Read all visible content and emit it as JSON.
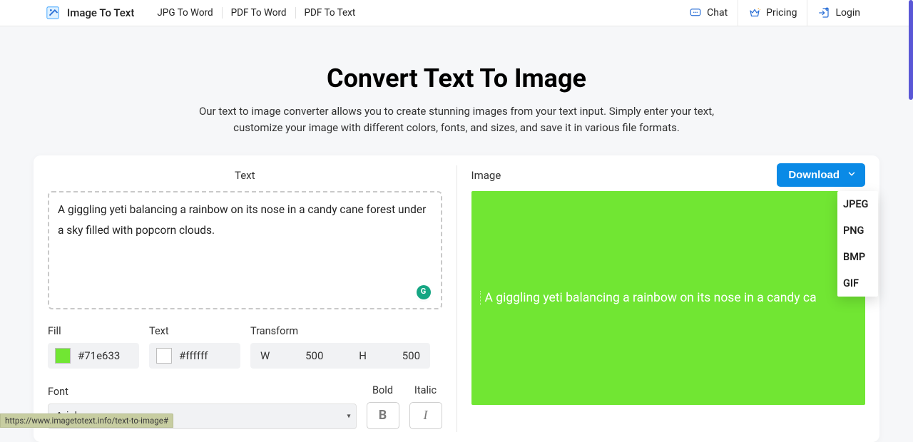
{
  "header": {
    "logo_text": "Image To Text",
    "nav": [
      "JPG To Word",
      "PDF To Word",
      "PDF To Text"
    ],
    "right": {
      "chat": "Chat",
      "pricing": "Pricing",
      "login": "Login"
    }
  },
  "page": {
    "title": "Convert Text To Image",
    "subtitle": "Our text to image converter allows you to create stunning images from your text input. Simply enter your text, customize your image with different colors, fonts, and sizes, and save it in various file formats."
  },
  "left_pane": {
    "title": "Text",
    "text_value": "A giggling yeti balancing a rainbow on its nose in a candy cane forest under a sky filled with popcorn clouds.",
    "fill_label": "Fill",
    "fill_value": "#71e633",
    "text_label": "Text",
    "text_color_value": "#ffffff",
    "transform_label": "Transform",
    "w_label": "W",
    "w_value": "500",
    "h_label": "H",
    "h_value": "500",
    "font_label": "Font",
    "font_value": "Arial",
    "bold_label": "Bold",
    "bold_btn": "B",
    "italic_label": "Italic",
    "italic_btn": "I",
    "grammarly_badge": "G"
  },
  "right_pane": {
    "title": "Image",
    "download_label": "Download",
    "preview_text": "A giggling yeti balancing a rainbow on its nose in a candy ca",
    "menu": [
      "JPEG",
      "PNG",
      "BMP",
      "GIF"
    ]
  },
  "status_url": "https://www.imagetotext.info/text-to-image#",
  "colors": {
    "accent_blue": "#0a8ae6",
    "fill_green": "#71e633",
    "grammarly": "#15a683"
  }
}
